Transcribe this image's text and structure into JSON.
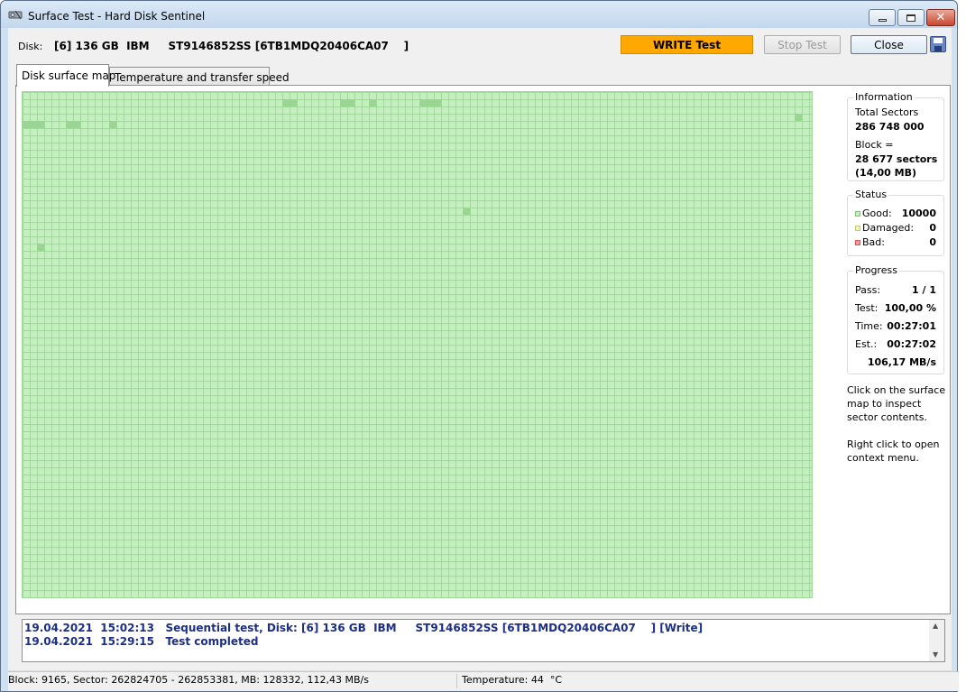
{
  "window": {
    "title": "Surface Test - Hard Disk Sentinel"
  },
  "header": {
    "disk_label": "Disk:",
    "disk_value": "[6] 136 GB  IBM     ST9146852SS [6TB1MDQ20406CA07    ]",
    "write_test_label": "WRITE Test",
    "stop_test_label": "Stop Test",
    "close_label": "Close"
  },
  "tabs": [
    {
      "label": "Disk surface map"
    },
    {
      "label": "Temperature and transfer speed"
    }
  ],
  "information": {
    "legend": "Information",
    "total_sectors_label": "Total Sectors",
    "total_sectors_value": "286 748 000",
    "block_label": "Block =",
    "block_sectors": "28 677 sectors",
    "block_mb": "(14,00 MB)"
  },
  "status": {
    "legend": "Status",
    "good_label": "Good:",
    "good_value": "10000",
    "damaged_label": "Damaged:",
    "damaged_value": "0",
    "bad_label": "Bad:",
    "bad_value": "0",
    "colors": {
      "good": "#c3f0be",
      "damaged": "#e8e8a0",
      "bad": "#e88080"
    }
  },
  "progress": {
    "legend": "Progress",
    "pass_label": "Pass:",
    "pass_value": "1 / 1",
    "test_label": "Test:",
    "test_value": "100,00 %",
    "time_label": "Time:",
    "time_value": "00:27:01",
    "est_label": "Est.:",
    "est_value": "00:27:02",
    "speed_value": "106,17 MB/s"
  },
  "hints": {
    "click_hint": "Click on the surface map to inspect sector contents.",
    "right_click_hint": "Right click to open context menu."
  },
  "log": [
    "19.04.2021  15:02:13   Sequential test, Disk: [6] 136 GB  IBM     ST9146852SS [6TB1MDQ20406CA07    ] [Write]",
    "19.04.2021  15:29:15   Test completed"
  ],
  "statusbar": {
    "block_info": "Block: 9165, Sector: 262824705 - 262853381, MB: 128332, 112,43 MB/s",
    "temperature": "Temperature: 44  °C"
  }
}
